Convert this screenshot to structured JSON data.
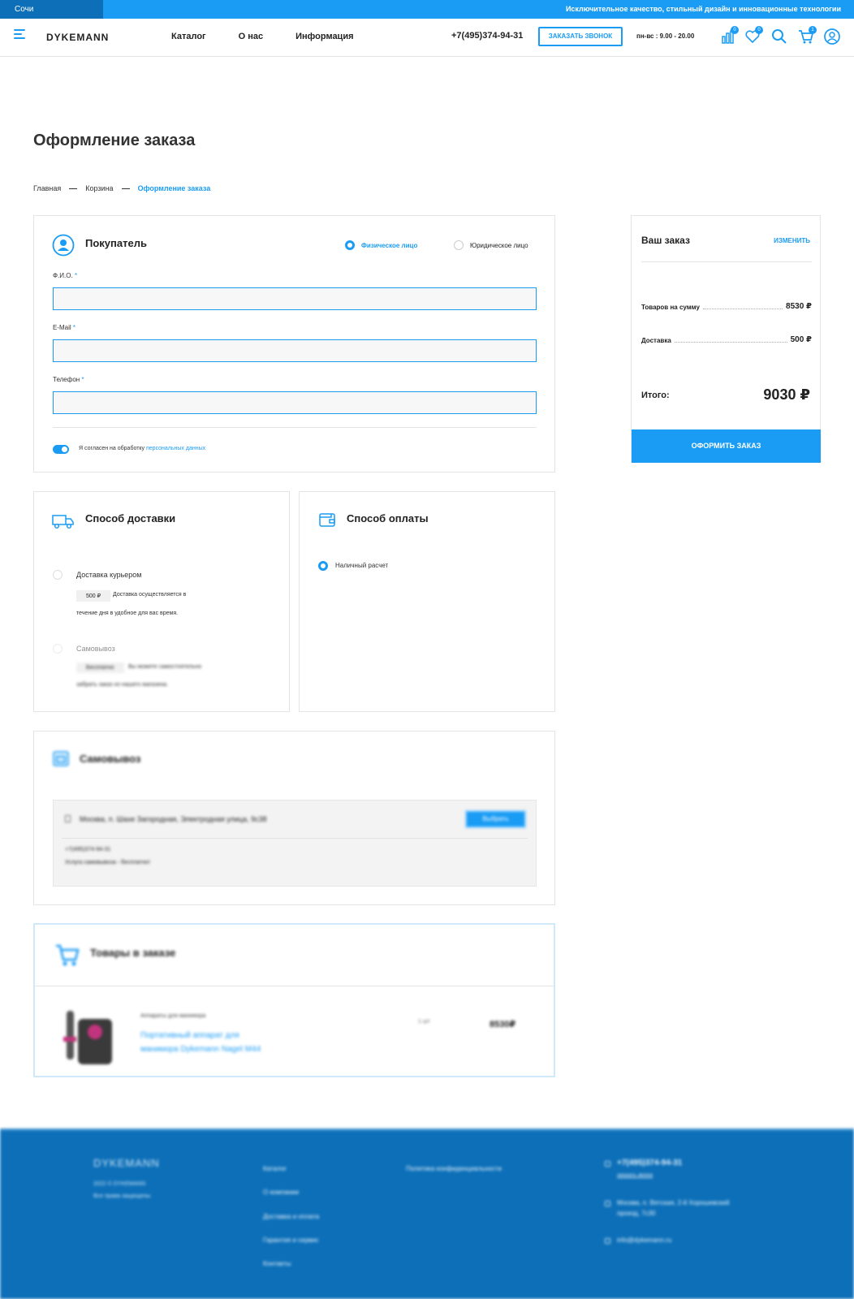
{
  "topbar": {
    "city": "Сочи",
    "slogan": "Исключительное качество, стильный дизайн и инновационные технологии"
  },
  "header": {
    "logo": "DYKEMANN",
    "nav": [
      "Каталог",
      "О нас",
      "Информация"
    ],
    "phone": "+7(495)374-94-31",
    "callback": "ЗАКАЗАТЬ ЗВОНОК",
    "hours": "пн-вс : 9.00 - 20.00",
    "badges": {
      "compare": "0",
      "favorites": "0",
      "cart": "1"
    }
  },
  "page": {
    "title": "Оформление заказа"
  },
  "breadcrumb": [
    "Главная",
    "Корзина",
    "Оформление заказа"
  ],
  "buyer": {
    "title": "Покупатель",
    "types": [
      "Физическое лицо",
      "Юридическое лицо"
    ],
    "fields": [
      {
        "label": "Ф.И.О.",
        "value": ""
      },
      {
        "label": "E-Mail",
        "value": ""
      },
      {
        "label": "Телефон",
        "value": ""
      }
    ],
    "required_mark": "*",
    "consent_text": "Я согласен на обработку",
    "consent_link": "персональных данных"
  },
  "summary": {
    "title": "Ваш заказ",
    "edit": "ИЗМЕНИТЬ",
    "goods_label": "Товаров на сумму",
    "goods_value": "8530 ₽",
    "delivery_label": "Доставка",
    "delivery_value": "500 ₽",
    "total_label": "Итого:",
    "total_value": "9030 ₽",
    "submit": "ОФОРМИТЬ ЗАКАЗ"
  },
  "delivery": {
    "title": "Способ доставки",
    "courier": {
      "label": "Доставка курьером",
      "price": "500 ₽",
      "desc1": "Доставка осуществляется в",
      "desc2": "течение дня в удобное для вас время."
    },
    "pickup": {
      "label": "Самовывоз",
      "price": "Бесплатно",
      "desc1": "Вы можете самостоятельно",
      "desc2": "забрать заказ из нашего магазина."
    }
  },
  "payment": {
    "title": "Способ оплаты",
    "option": "Наличный расчет"
  },
  "pickup_block": {
    "title": "Самовывоз",
    "address": "Москва, п. Шахе Загородная, Электродная улица, 9с38",
    "choose": "Выбрать",
    "phone": "+7(495)374-94-31",
    "note": "Услуга самовывоза - бесплатно!"
  },
  "goods": {
    "title": "Товары в заказе",
    "category": "Аппараты для маникюра",
    "name_line1": "Портативный аппарат для",
    "name_line2": "маникюра Dykemann Nagel M44",
    "qty": "1 шт",
    "price": "8530₽"
  },
  "footer": {
    "logo": "DYKEMANN",
    "copy1": "2022 © DYKEMANN",
    "copy2": "Все права защищены",
    "links": [
      "Каталог",
      "О компании",
      "Доставка и оплата",
      "Гарантия и сервис",
      "Контакты"
    ],
    "policy": "Политика конфиденциальности",
    "phone": "+7(495)374-94-31",
    "callback": "заказать звонок",
    "address1": "Москва, п. Вятская, 2-й Хорошевский",
    "address2": "проезд, 7с30",
    "email": "info@dykemann.ru"
  }
}
